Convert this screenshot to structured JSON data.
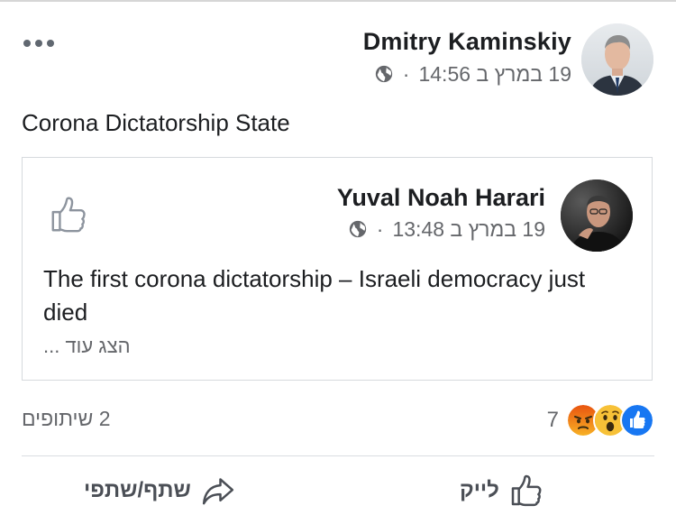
{
  "post": {
    "author": "Dmitry Kaminskiy",
    "timestamp": "19 במרץ ב 14:56",
    "meta_separator": "·",
    "privacy_icon": "globe-icon",
    "text": "Corona Dictatorship State"
  },
  "shared": {
    "author": "Yuval Noah Harari",
    "timestamp": "19 במרץ ב 13:48",
    "meta_separator": "·",
    "privacy_icon": "globe-icon",
    "text": "The first corona dictatorship – Israeli democracy just died",
    "see_more": "... הצג עוד"
  },
  "stats": {
    "shares": "2 שיתופים",
    "reaction_count": "7",
    "reactions": [
      "like-icon",
      "wow-icon",
      "angry-icon"
    ]
  },
  "actions": {
    "like_label": "לייק",
    "share_label": "שתף/שתפי"
  },
  "colors": {
    "facebook_blue": "#1877f2",
    "reaction_yellow": "#f7b125",
    "reaction_angry": "#e9710f",
    "secondary_text": "#65676b"
  }
}
